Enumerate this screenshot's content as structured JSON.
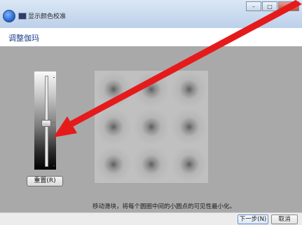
{
  "window": {
    "title": "显示颜色校准",
    "controls": {
      "minimize": "–",
      "maximize": "□",
      "close": "✕"
    }
  },
  "header": {
    "title": "调整伽玛"
  },
  "main": {
    "reset_label": "重置(R)",
    "instruction": "移动滑块，将每个圆圈中间的小圆点的可见性最小化。",
    "gamma_slider_level": 0.52
  },
  "footer": {
    "next_label": "下一步(N)",
    "cancel_label": "取消"
  },
  "icons": {
    "back": "back-arrow-icon",
    "app": "display-color-calibration-icon"
  },
  "colors": {
    "annotation_arrow": "#e51b1b",
    "title_text": "#1b3f86"
  }
}
